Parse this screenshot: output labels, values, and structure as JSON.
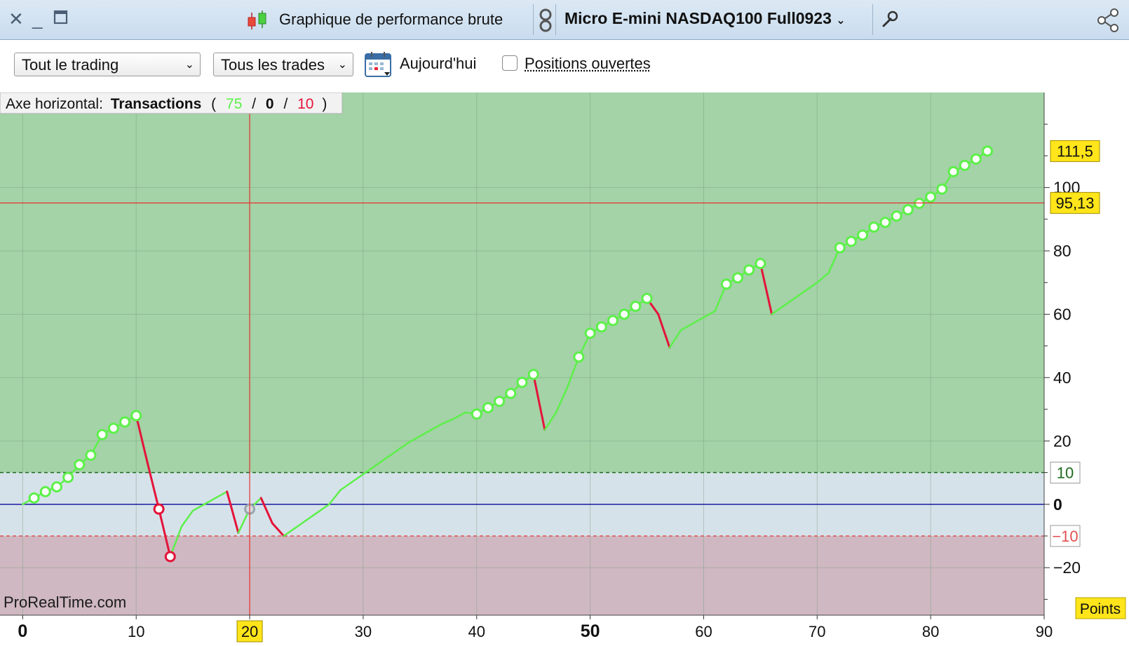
{
  "window": {
    "title": "Graphique de performance brute",
    "instrument": "Micro E-mini NASDAQ100 Full0923"
  },
  "toolbar": {
    "scope_select": "Tout le trading",
    "trades_select": "Tous les trades",
    "today_label": "Aujourd'hui",
    "open_positions_label": "Positions ouvertes",
    "open_positions_checked": false
  },
  "legend": {
    "prefix": "Axe horizontal:",
    "axis_name": "Transactions",
    "open": "(",
    "wins": "75",
    "sep1": "/",
    "neutral": "0",
    "sep2": "/",
    "losses": "10",
    "close": ")"
  },
  "watermark": "ProRealTime.com",
  "unit_label": "Points",
  "colors": {
    "win_line": "#5df04a",
    "loss_line": "#e4143a",
    "zero_line": "#1a1aa0",
    "crosshair": "#e8302e",
    "profit_zone": "#a3d3a6",
    "neutral_zone": "#d6e2ea",
    "loss_zone": "#cfb8c1",
    "highlight_label": "#ffe51a"
  },
  "chart_data": {
    "type": "line",
    "xlabel": "",
    "ylabel": "",
    "xlim": [
      -2,
      90
    ],
    "ylim": [
      -35,
      130
    ],
    "x_ticks": [
      0,
      10,
      20,
      30,
      40,
      50,
      60,
      70,
      80,
      90
    ],
    "x_tick_labels": [
      "0",
      "10",
      "20",
      "30",
      "40",
      "50",
      "60",
      "70",
      "80",
      "90"
    ],
    "y_ticks": [
      -20,
      0,
      20,
      40,
      60,
      80,
      100
    ],
    "y_tick_labels": [
      "−20",
      "0",
      "20",
      "40",
      "60",
      "80",
      "100"
    ],
    "profit_threshold": 10,
    "loss_threshold": -10,
    "threshold_labels": [
      "10",
      "−10"
    ],
    "crosshair": {
      "x": 20,
      "y": 95.13,
      "x_label": "20",
      "y_label": "95,13"
    },
    "last_value_label": "111,5",
    "series": [
      {
        "points": [
          [
            0,
            0
          ],
          [
            1,
            2
          ],
          [
            2,
            4
          ],
          [
            3,
            5.5
          ],
          [
            4,
            8.5
          ],
          [
            5,
            12.5
          ],
          [
            6,
            15.5
          ],
          [
            7,
            22
          ],
          [
            8,
            24
          ],
          [
            9,
            26
          ],
          [
            10,
            28
          ],
          [
            11,
            13
          ],
          [
            12,
            -1.5
          ],
          [
            13,
            -16.5
          ],
          [
            14,
            -7
          ],
          [
            15,
            -2
          ],
          [
            16,
            0
          ],
          [
            17,
            2
          ],
          [
            18,
            4
          ],
          [
            19,
            -9
          ],
          [
            20,
            -1.5
          ],
          [
            21,
            2
          ],
          [
            22,
            -6
          ],
          [
            23,
            -10
          ],
          [
            24,
            -7.5
          ],
          [
            25,
            -5
          ],
          [
            26,
            -2.5
          ],
          [
            27,
            0
          ],
          [
            28,
            4.5
          ],
          [
            29,
            7
          ],
          [
            30,
            9.5
          ],
          [
            31,
            12
          ],
          [
            32,
            14.5
          ],
          [
            33,
            17
          ],
          [
            34,
            19.5
          ],
          [
            35,
            21.5
          ],
          [
            36,
            23.5
          ],
          [
            37,
            25.5
          ],
          [
            38,
            27
          ],
          [
            39,
            29
          ],
          [
            40,
            28.5
          ],
          [
            41,
            30.5
          ],
          [
            42,
            32.5
          ],
          [
            43,
            35
          ],
          [
            44,
            38.5
          ],
          [
            45,
            41
          ],
          [
            46,
            23.5
          ],
          [
            47,
            29
          ],
          [
            48,
            37
          ],
          [
            49,
            46.5
          ],
          [
            50,
            54
          ],
          [
            51,
            56
          ],
          [
            52,
            58
          ],
          [
            53,
            60
          ],
          [
            54,
            62.5
          ],
          [
            55,
            65
          ],
          [
            56,
            60
          ],
          [
            57,
            49.5
          ],
          [
            58,
            55
          ],
          [
            59,
            57
          ],
          [
            60,
            59
          ],
          [
            61,
            61
          ],
          [
            62,
            69.5
          ],
          [
            63,
            71.5
          ],
          [
            64,
            74
          ],
          [
            65,
            76
          ],
          [
            66,
            60
          ],
          [
            67,
            62.5
          ],
          [
            68,
            65
          ],
          [
            69,
            67.5
          ],
          [
            70,
            70
          ],
          [
            71,
            73
          ],
          [
            72,
            81
          ],
          [
            73,
            83
          ],
          [
            74,
            85
          ],
          [
            75,
            87.5
          ],
          [
            76,
            89
          ],
          [
            77,
            91
          ],
          [
            78,
            93
          ],
          [
            79,
            95
          ],
          [
            80,
            97
          ],
          [
            81,
            99.5
          ],
          [
            82,
            105
          ],
          [
            83,
            107
          ],
          [
            84,
            109
          ],
          [
            85,
            111.5
          ]
        ],
        "losing_trades": [
          11,
          12,
          13,
          19,
          22,
          23,
          46,
          56,
          57,
          66
        ],
        "neutral_trades": [
          20
        ],
        "marked_points": [
          1,
          2,
          3,
          4,
          5,
          6,
          7,
          8,
          9,
          10,
          12,
          13,
          20,
          40,
          41,
          42,
          43,
          44,
          45,
          49,
          50,
          51,
          52,
          53,
          54,
          55,
          62,
          63,
          64,
          65,
          72,
          73,
          74,
          75,
          76,
          77,
          78,
          79,
          80,
          81,
          82,
          83,
          84,
          85
        ]
      }
    ]
  }
}
